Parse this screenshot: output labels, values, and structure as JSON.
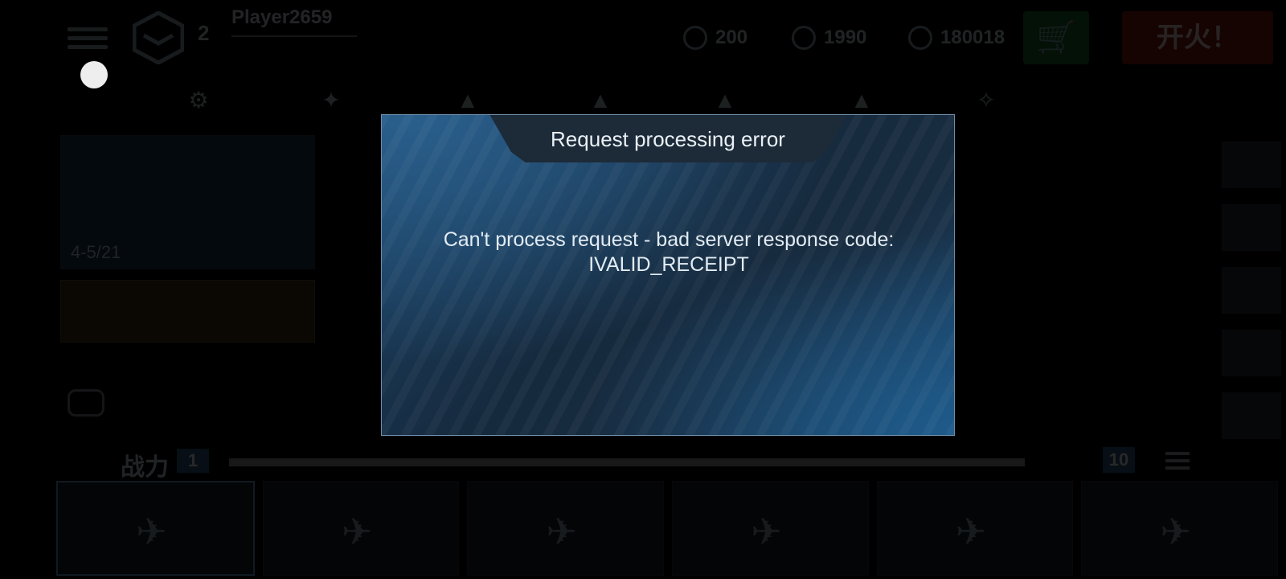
{
  "background": {
    "player": {
      "name": "Player2659",
      "level": "2"
    },
    "currencies": [
      {
        "icon": "fuel-icon",
        "value": "200"
      },
      {
        "icon": "silver-coin-icon",
        "value": "1990"
      },
      {
        "icon": "gold-coin-icon",
        "value": "180018"
      }
    ],
    "cart_icon": "cart-icon",
    "fire_button_label": "开火！",
    "left_card_count": "4-5/21",
    "power_label": "战力",
    "power_level": "1",
    "slot_count": "10"
  },
  "dialog": {
    "title": "Request processing error",
    "message_line1": "Can't process request - bad server response code:",
    "message_line2": "IVALID_RECEIPT"
  },
  "colors": {
    "dialog_border": "#6f8ea8",
    "dialog_bg": "#152a3e",
    "cart_button": "#1f6b2a",
    "fire_button": "#8a1d12"
  }
}
